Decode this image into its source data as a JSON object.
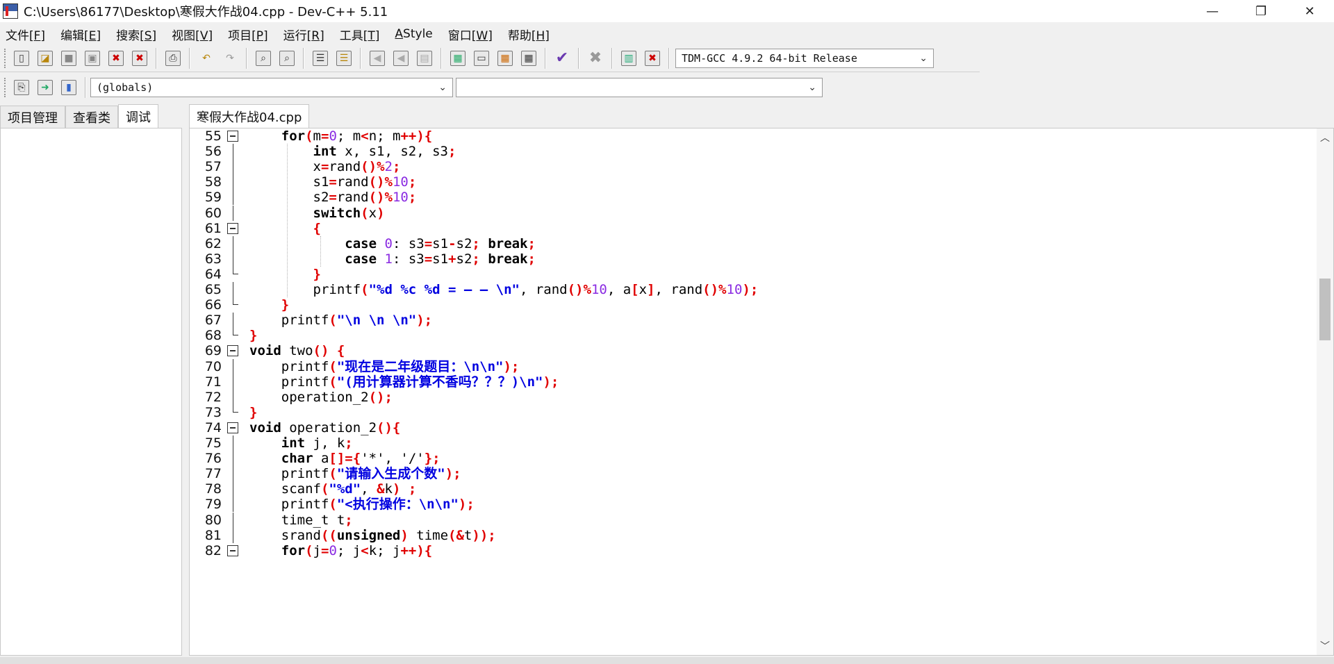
{
  "window": {
    "title": "C:\\Users\\86177\\Desktop\\寒假大作战04.cpp - Dev-C++ 5.11",
    "controls": {
      "minimize": "—",
      "restore": "❐",
      "close": "✕"
    }
  },
  "menu": [
    {
      "label": "文件[",
      "key": "F",
      "end": "]"
    },
    {
      "label": "编辑[",
      "key": "E",
      "end": "]"
    },
    {
      "label": "搜索[",
      "key": "S",
      "end": "]"
    },
    {
      "label": "视图[",
      "key": "V",
      "end": "]"
    },
    {
      "label": "项目[",
      "key": "P",
      "end": "]"
    },
    {
      "label": "运行[",
      "key": "R",
      "end": "]"
    },
    {
      "label": "工具[",
      "key": "T",
      "end": "]"
    },
    {
      "label": "",
      "key": "A",
      "end": "Style"
    },
    {
      "label": "窗口[",
      "key": "W",
      "end": "]"
    },
    {
      "label": "帮助[",
      "key": "H",
      "end": "]"
    }
  ],
  "toolbar": {
    "compiler": "TDM-GCC 4.9.2 64-bit Release",
    "globals": "(globals)",
    "members": ""
  },
  "left_tabs": [
    "项目管理",
    "查看类",
    "调试"
  ],
  "editor_tab": "寒假大作战04.cpp",
  "scroll": {
    "thumb_top_fraction": 0.27,
    "thumb_size_fraction": 0.125
  },
  "lines": [
    {
      "n": "55",
      "fold": "open"
    },
    {
      "n": "56",
      "fold": "line"
    },
    {
      "n": "57",
      "fold": "line"
    },
    {
      "n": "58",
      "fold": "line"
    },
    {
      "n": "59",
      "fold": "line"
    },
    {
      "n": "60",
      "fold": "line"
    },
    {
      "n": "61",
      "fold": "open"
    },
    {
      "n": "62",
      "fold": "line"
    },
    {
      "n": "63",
      "fold": "line"
    },
    {
      "n": "64",
      "fold": "end"
    },
    {
      "n": "65",
      "fold": "line"
    },
    {
      "n": "66",
      "fold": "end"
    },
    {
      "n": "67",
      "fold": "line"
    },
    {
      "n": "68",
      "fold": "end"
    },
    {
      "n": "69",
      "fold": "open"
    },
    {
      "n": "70",
      "fold": "line"
    },
    {
      "n": "71",
      "fold": "line"
    },
    {
      "n": "72",
      "fold": "line"
    },
    {
      "n": "73",
      "fold": "end"
    },
    {
      "n": "74",
      "fold": "open"
    },
    {
      "n": "75",
      "fold": "line"
    },
    {
      "n": "76",
      "fold": "line"
    },
    {
      "n": "77",
      "fold": "line"
    },
    {
      "n": "78",
      "fold": "line"
    },
    {
      "n": "79",
      "fold": "line"
    },
    {
      "n": "80",
      "fold": "line"
    },
    {
      "n": "81",
      "fold": "line"
    },
    {
      "n": "82",
      "fold": "open"
    }
  ],
  "code_tokens": [
    [
      [
        "    ",
        ""
      ],
      [
        "for",
        "k"
      ],
      [
        "(",
        "p"
      ],
      [
        "m",
        ""
      ],
      [
        "=",
        "p"
      ],
      [
        "0",
        "n"
      ],
      [
        "; m",
        ""
      ],
      [
        "<",
        "p"
      ],
      [
        "n; m",
        ""
      ],
      [
        "++",
        "p"
      ],
      [
        "){",
        "p"
      ]
    ],
    [
      [
        "        ",
        ""
      ],
      [
        "int",
        "k"
      ],
      [
        " x, s1, s2, s3",
        ""
      ],
      [
        ";",
        "p"
      ]
    ],
    [
      [
        "        x",
        ""
      ],
      [
        "=",
        "p"
      ],
      [
        "rand",
        ""
      ],
      [
        "()",
        "p"
      ],
      [
        "%",
        "p"
      ],
      [
        "2",
        "n"
      ],
      [
        ";",
        "p"
      ]
    ],
    [
      [
        "        s1",
        ""
      ],
      [
        "=",
        "p"
      ],
      [
        "rand",
        ""
      ],
      [
        "()",
        "p"
      ],
      [
        "%",
        "p"
      ],
      [
        "10",
        "n"
      ],
      [
        ";",
        "p"
      ]
    ],
    [
      [
        "        s2",
        ""
      ],
      [
        "=",
        "p"
      ],
      [
        "rand",
        ""
      ],
      [
        "()",
        "p"
      ],
      [
        "%",
        "p"
      ],
      [
        "10",
        "n"
      ],
      [
        ";",
        "p"
      ]
    ],
    [
      [
        "        ",
        ""
      ],
      [
        "switch",
        "k"
      ],
      [
        "(",
        "p"
      ],
      [
        "x",
        ""
      ],
      [
        ")",
        "p"
      ]
    ],
    [
      [
        "        ",
        ""
      ],
      [
        "{",
        "p"
      ]
    ],
    [
      [
        "            ",
        ""
      ],
      [
        "case",
        "k"
      ],
      [
        " ",
        ""
      ],
      [
        "0",
        "n"
      ],
      [
        ": s3",
        ""
      ],
      [
        "=",
        "p"
      ],
      [
        "s1",
        ""
      ],
      [
        "-",
        "p"
      ],
      [
        "s2",
        ""
      ],
      [
        ";",
        "p"
      ],
      [
        " ",
        ""
      ],
      [
        "break",
        "k"
      ],
      [
        ";",
        "p"
      ]
    ],
    [
      [
        "            ",
        ""
      ],
      [
        "case",
        "k"
      ],
      [
        " ",
        ""
      ],
      [
        "1",
        "n"
      ],
      [
        ": s3",
        ""
      ],
      [
        "=",
        "p"
      ],
      [
        "s1",
        ""
      ],
      [
        "+",
        "p"
      ],
      [
        "s2",
        ""
      ],
      [
        ";",
        "p"
      ],
      [
        " ",
        ""
      ],
      [
        "break",
        "k"
      ],
      [
        ";",
        "p"
      ]
    ],
    [
      [
        "        ",
        ""
      ],
      [
        "}",
        "p"
      ]
    ],
    [
      [
        "        printf",
        ""
      ],
      [
        "(",
        "p"
      ],
      [
        "\"%d %c %d = — — \\n\"",
        "s"
      ],
      [
        ", rand",
        ""
      ],
      [
        "()",
        "p"
      ],
      [
        "%",
        "p"
      ],
      [
        "10",
        "n"
      ],
      [
        ", a",
        ""
      ],
      [
        "[",
        "p"
      ],
      [
        "x",
        ""
      ],
      [
        "]",
        "p"
      ],
      [
        ", rand",
        ""
      ],
      [
        "()",
        "p"
      ],
      [
        "%",
        "p"
      ],
      [
        "10",
        "n"
      ],
      [
        ");",
        "p"
      ]
    ],
    [
      [
        "    ",
        ""
      ],
      [
        "}",
        "p"
      ]
    ],
    [
      [
        "    printf",
        ""
      ],
      [
        "(",
        "p"
      ],
      [
        "\"\\n \\n \\n\"",
        "s"
      ],
      [
        ");",
        "p"
      ]
    ],
    [
      [
        "",
        ""
      ],
      [
        "}",
        "p"
      ]
    ],
    [
      [
        "",
        ""
      ],
      [
        "void",
        "k"
      ],
      [
        " two",
        ""
      ],
      [
        "() {",
        "p"
      ]
    ],
    [
      [
        "    printf",
        ""
      ],
      [
        "(",
        "p"
      ],
      [
        "\"现在是二年级题目：\\n\\n\"",
        "s"
      ],
      [
        ");",
        "p"
      ]
    ],
    [
      [
        "    printf",
        ""
      ],
      [
        "(",
        "p"
      ],
      [
        "\"(用计算器计算不香吗？？？)\\n\"",
        "s"
      ],
      [
        ");",
        "p"
      ]
    ],
    [
      [
        "    operation_2",
        ""
      ],
      [
        "();",
        "p"
      ]
    ],
    [
      [
        "",
        ""
      ],
      [
        "}",
        "p"
      ]
    ],
    [
      [
        "",
        ""
      ],
      [
        "void",
        "k"
      ],
      [
        " operation_2",
        ""
      ],
      [
        "(){",
        "p"
      ]
    ],
    [
      [
        "    ",
        ""
      ],
      [
        "int",
        "k"
      ],
      [
        " j, k",
        ""
      ],
      [
        ";",
        "p"
      ]
    ],
    [
      [
        "    ",
        ""
      ],
      [
        "char",
        "k"
      ],
      [
        " a",
        ""
      ],
      [
        "[]={",
        "p"
      ],
      [
        "'*'",
        ""
      ],
      [
        ", ",
        ""
      ],
      [
        "'/'",
        ""
      ],
      [
        "};",
        "p"
      ]
    ],
    [
      [
        "    printf",
        ""
      ],
      [
        "(",
        "p"
      ],
      [
        "\"请输入生成个数\"",
        "s"
      ],
      [
        ");",
        "p"
      ]
    ],
    [
      [
        "    scanf",
        ""
      ],
      [
        "(",
        "p"
      ],
      [
        "\"%d\"",
        "s"
      ],
      [
        ", ",
        ""
      ],
      [
        "&",
        "p"
      ],
      [
        "k",
        ""
      ],
      [
        ") ;",
        "p"
      ]
    ],
    [
      [
        "    printf",
        ""
      ],
      [
        "(",
        "p"
      ],
      [
        "\"<执行操作：\\n\\n\"",
        "s"
      ],
      [
        ");",
        "p"
      ]
    ],
    [
      [
        "    time_t t",
        ""
      ],
      [
        ";",
        "p"
      ]
    ],
    [
      [
        "    srand",
        ""
      ],
      [
        "((",
        "p"
      ],
      [
        "unsigned",
        "k"
      ],
      [
        ")",
        "p"
      ],
      [
        " time",
        ""
      ],
      [
        "(",
        "p"
      ],
      [
        "&",
        "p"
      ],
      [
        "t",
        ""
      ],
      [
        "));",
        "p"
      ]
    ],
    [
      [
        "    ",
        ""
      ],
      [
        "for",
        "k"
      ],
      [
        "(",
        "p"
      ],
      [
        "j",
        ""
      ],
      [
        "=",
        "p"
      ],
      [
        "0",
        "n"
      ],
      [
        "; j",
        ""
      ],
      [
        "<",
        "p"
      ],
      [
        "k; j",
        ""
      ],
      [
        "++",
        "p"
      ],
      [
        "){",
        "p"
      ]
    ]
  ]
}
